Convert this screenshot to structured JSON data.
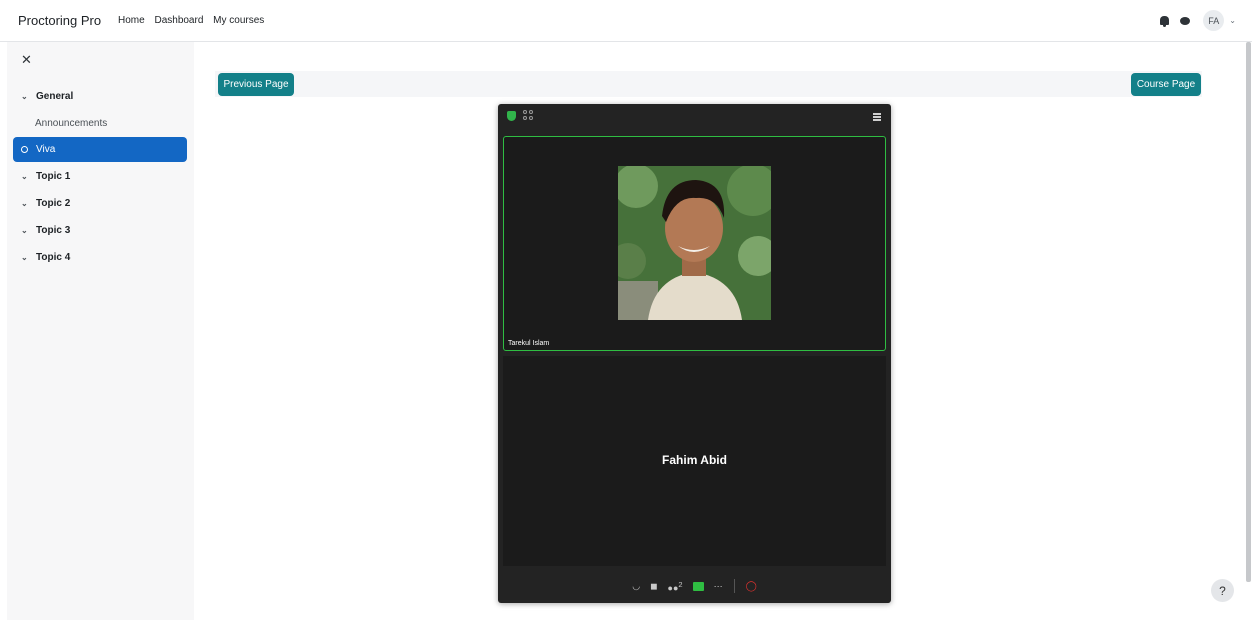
{
  "topnav": {
    "brand": "Proctoring Pro",
    "links": [
      "Home",
      "Dashboard",
      "My courses"
    ],
    "user_initials": "FA"
  },
  "drawer": {
    "items": [
      {
        "label": "General"
      },
      {
        "label": "Announcements"
      },
      {
        "label": "Viva"
      },
      {
        "label": "Topic 1"
      },
      {
        "label": "Topic 2"
      },
      {
        "label": "Topic 3"
      },
      {
        "label": "Topic 4"
      }
    ]
  },
  "page": {
    "prev_label": "Previous Page",
    "course_label": "Course Page"
  },
  "meeting": {
    "participant1": "Tarekul Islam",
    "participant2": "Fahim Abid",
    "participant_count": "2"
  },
  "colors": {
    "accent": "#138089",
    "active": "#1367c4",
    "speaking_border": "#2fbd42",
    "end_call": "#e0322f"
  },
  "icons": [
    "bell-icon",
    "chat-icon",
    "shield-icon",
    "gallery-icon",
    "menu-icon",
    "headphone-icon",
    "camera-off-icon",
    "participants-icon",
    "share-icon",
    "more-icon",
    "end-call-icon",
    "help-icon"
  ]
}
